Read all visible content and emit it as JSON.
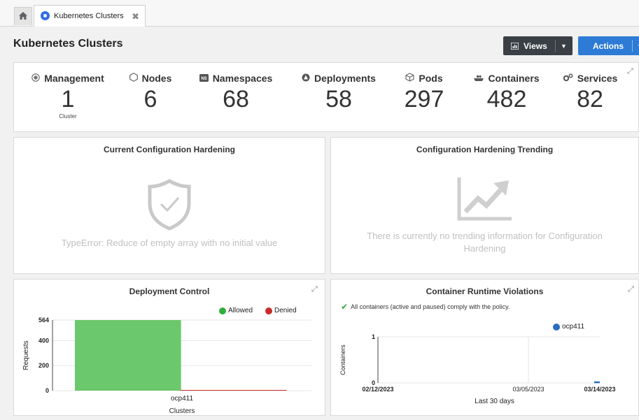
{
  "tabs": {
    "home_icon": "home-icon",
    "active": {
      "label": "Kubernetes Clusters",
      "icon": "kubernetes-icon",
      "close_glyph": "✖"
    }
  },
  "header": {
    "title": "Kubernetes Clusters",
    "views_label": "Views",
    "actions_label": "Actions"
  },
  "stats": [
    {
      "key": "management",
      "label": "Management",
      "icon": "management-icon",
      "value": "1",
      "sub": "Cluster"
    },
    {
      "key": "nodes",
      "label": "Nodes",
      "icon": "node-hexagon-icon",
      "value": "6",
      "sub": ""
    },
    {
      "key": "namespaces",
      "label": "Namespaces",
      "icon": "namespace-icon",
      "value": "68",
      "sub": ""
    },
    {
      "key": "deployments",
      "label": "Deployments",
      "icon": "deployment-icon",
      "value": "58",
      "sub": ""
    },
    {
      "key": "pods",
      "label": "Pods",
      "icon": "pod-cube-icon",
      "value": "297",
      "sub": ""
    },
    {
      "key": "containers",
      "label": "Containers",
      "icon": "container-ship-icon",
      "value": "482",
      "sub": ""
    },
    {
      "key": "services",
      "label": "Services",
      "icon": "services-cogs-icon",
      "value": "82",
      "sub": ""
    }
  ],
  "hardening": {
    "title": "Current Configuration Hardening",
    "message": "TypeError: Reduce of empty array with no initial value"
  },
  "trending": {
    "title": "Configuration Hardening Trending",
    "message": "There is currently no trending information for Configuration Hardening"
  },
  "deployment_control": {
    "title": "Deployment Control",
    "chart_data": {
      "type": "bar",
      "title": "Deployment Control",
      "categories": [
        "ocp411"
      ],
      "series": [
        {
          "name": "Allowed",
          "values": [
            564
          ],
          "color": "#6cc86c"
        },
        {
          "name": "Denied",
          "values": [
            0
          ],
          "color": "#cc2a2a"
        }
      ],
      "xlabel": "Clusters",
      "ylabel": "Requests",
      "ylim": [
        0,
        564
      ],
      "yticks": [
        "0",
        "200",
        "400",
        "564"
      ],
      "legend": "top-right",
      "grid": true
    }
  },
  "runtime_violations": {
    "title": "Container Runtime Violations",
    "compliance_note": "All containers (active and paused) comply with the policy.",
    "chart_data": {
      "type": "line",
      "title": "Container Runtime Violations",
      "x": [
        "02/12/2023",
        "03/05/2023",
        "03/14/2023"
      ],
      "series": [
        {
          "name": "ocp411",
          "values": [
            0,
            0,
            0
          ],
          "color": "#2a6ebd"
        }
      ],
      "xlabel": "Last 30 days",
      "ylabel": "Containers",
      "ylim": [
        0,
        1
      ],
      "yticks": [
        "0",
        "1"
      ],
      "legend": "top-right",
      "grid": true
    }
  }
}
